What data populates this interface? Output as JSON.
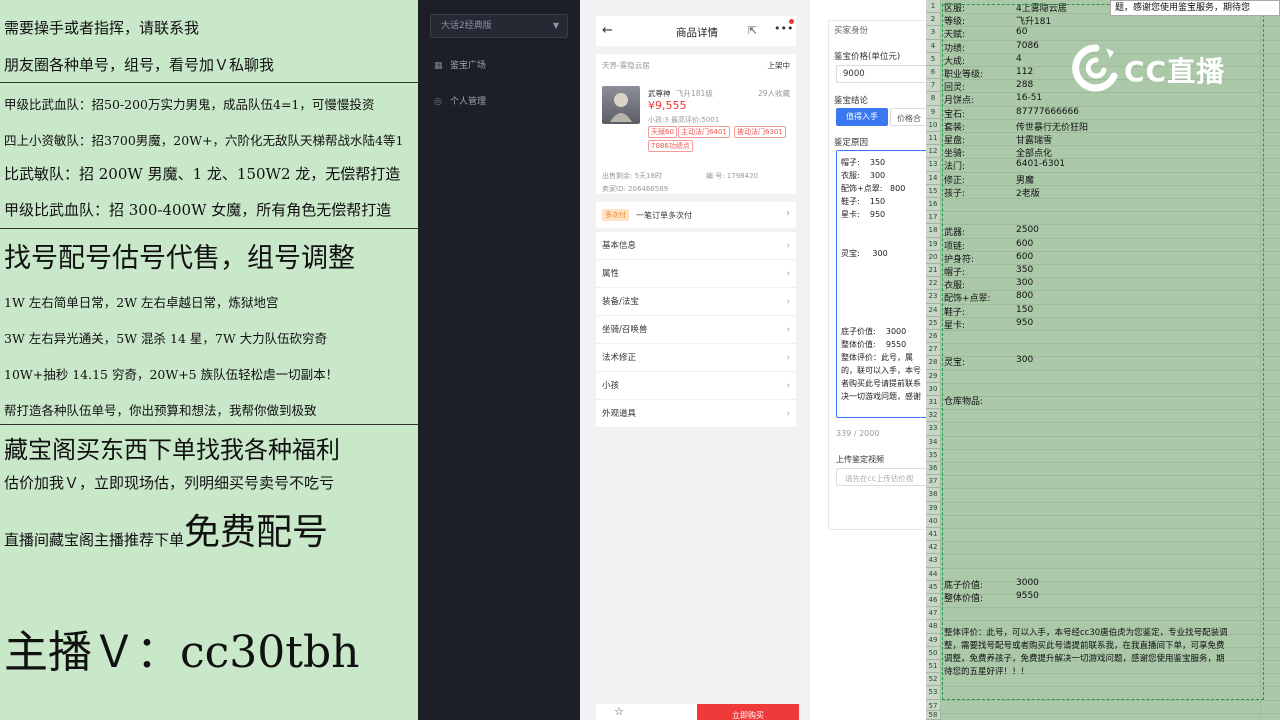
{
  "promo": {
    "line1": "需要操手或者指挥，请联系我",
    "line2": "朋友圈各种单号，组号，看号加Ｖ私聊我",
    "line3": "甲级比武血队：招50-200万实力男鬼，成品队伍4=1，可慢慢投资",
    "line4": "四上小资敏队：招3700男魔，20W+，六阶化无敌队天梯帮战水陆4等1",
    "line5": "比武敏队：招 200W 男魔、1 龙、150W2 龙，无偿帮打造",
    "line6": "甲级比武血队：招 300-400W 女魔，所有角色无偿帮打造",
    "line7": "找号配号估号代售，组号调整",
    "line8": "1W 左右简单日常，2W 左右卓越日常，炼狱地宫",
    "line9": "3W 左右异光通关，5W 混杀 14 星，7W 大力队伍砍穷奇",
    "line10": "10W+抽秒 14.15 穷奇，20W+5 族队伍轻松虐一切副本！",
    "line11": "帮打造各种队伍单号，你出预算和想法，我帮你做到极致",
    "line12": "藏宝阁买东西下单找我各种福利",
    "line13": "估价加我Ｖ，立即现场估，列明细买号卖号不吃亏",
    "line14a": "直播间藏宝阁主播推荐下单",
    "line14b": "免费配号",
    "line15": "主播Ｖ：cc30tbh"
  },
  "darkside": {
    "select_value": "大话2经典版",
    "nav1": "鉴宝广场",
    "nav2": "个人管理"
  },
  "phone": {
    "title": "商品详情",
    "server": "天界-雾隐云居",
    "status": "上架中",
    "char_name": "武尊神",
    "char_level": "飞升181级",
    "favorites": "29人收藏",
    "price": "¥9,555",
    "sub": "小孩:3 最高评价:5001",
    "tag1": "天赋60",
    "tag2": "主动法门6401",
    "tag3": "被动法门6301",
    "tag4": "7086功绩点",
    "remaining": "出售剩余: 5天18时",
    "serial": "编 号: 1798420",
    "seller": "卖家ID: 206466589",
    "promo_tag": "多次付",
    "promo_text": "一笔订单多次付",
    "rows": [
      "基本信息",
      "属性",
      "装备/法宝",
      "坐骑/召唤兽",
      "法术修正",
      "小孩",
      "外观道具"
    ],
    "buy_button": "立即购买"
  },
  "form": {
    "section": "买家身份",
    "price_label": "鉴宝价格(单位元)",
    "price_value": "9000",
    "conclusion_label": "鉴宝结论",
    "btn_worth": "值得入手",
    "btn_fair": "价格合",
    "reason_label": "鉴定原因",
    "reason_lines": [
      [
        "帽子:",
        "350"
      ],
      [
        "衣服:",
        "300"
      ],
      [
        "配饰+点翠:",
        "800"
      ],
      [
        "鞋子:",
        "150"
      ],
      [
        "星卡:",
        "950"
      ],
      [
        "",
        ""
      ],
      [
        "",
        ""
      ],
      [
        "灵宝:",
        "300"
      ]
    ],
    "base_label": "底子价值:",
    "base_value": "3000",
    "total_label": "整体价值:",
    "total_value": "9550",
    "eval_line1": "整体评价：此号，属",
    "eval_line2": "的，联可以入手，本号",
    "eval_line3": "者购买此号请提前联系",
    "eval_line4": "决一切游戏问题，感谢",
    "counter": "339 / 2000",
    "video_label": "上传鉴定视频",
    "video_placeholder": "请先在cc上传估价视"
  },
  "sheet": {
    "top_tip": "题，感谢您使用鉴宝服务，期待您",
    "logo_text": "CC直播",
    "rows": [
      {
        "n": "1",
        "k": "区服:",
        "v": "4上雾隐云居"
      },
      {
        "n": "2",
        "k": "等级:",
        "v": "飞升181"
      },
      {
        "n": "3",
        "k": "天赋:",
        "v": "60"
      },
      {
        "n": "4",
        "k": "功绩:",
        "v": "7086"
      },
      {
        "n": "5",
        "k": "大成:",
        "v": "4"
      },
      {
        "n": "6",
        "k": "职业等级:",
        "v": "112"
      },
      {
        "n": "7",
        "k": "回灵:",
        "v": "288"
      },
      {
        "n": "8",
        "k": "月饼点:",
        "v": "16-51"
      },
      {
        "n": "9",
        "k": "宝石:",
        "v": "87777666666"
      },
      {
        "n": "10",
        "k": "套装:",
        "v": "传世暴行无价狂阳"
      },
      {
        "n": "11",
        "k": "星盘:",
        "v": "甘露瑞雪"
      },
      {
        "n": "12",
        "k": "坐骑:",
        "v": "全部点化"
      },
      {
        "n": "13",
        "k": "法门:",
        "v": "6401-6301"
      },
      {
        "n": "14",
        "k": "修正:",
        "v": "男魔"
      },
      {
        "n": "15",
        "k": "孩子:",
        "v": "2老版"
      },
      {
        "n": "16",
        "k": "",
        "v": ""
      },
      {
        "n": "17",
        "k": "",
        "v": ""
      },
      {
        "n": "18",
        "k": "武器:",
        "v": "2500"
      },
      {
        "n": "19",
        "k": "项链:",
        "v": "600"
      },
      {
        "n": "20",
        "k": "护身符:",
        "v": "600"
      },
      {
        "n": "21",
        "k": "帽子:",
        "v": "350"
      },
      {
        "n": "22",
        "k": "衣服:",
        "v": "300"
      },
      {
        "n": "23",
        "k": "配饰+点翠:",
        "v": "800"
      },
      {
        "n": "24",
        "k": "鞋子:",
        "v": "150"
      },
      {
        "n": "25",
        "k": "星卡:",
        "v": "950"
      }
    ],
    "lingbao_k": "灵宝:",
    "lingbao_v": "300",
    "warehouse": "仓库物品:",
    "base_k": "底子价值:",
    "base_v": "3000",
    "total_k": "整体价值:",
    "total_v": "9550",
    "eval_lines": [
      "整体评价：此号，可以入手，本号经cc30唐伯虎为您鉴定，专业找号配装调",
      "整，需要找号配号或者购买此号请提前联系我，在我直播间下单，可享免费",
      "调整，免费养孩子，免费提升解决一切游戏问题，感谢您使用鉴宝服务，期",
      "待您的五星好评！！！"
    ],
    "bottom_rows": [
      "57",
      "58"
    ]
  },
  "colors": {
    "promo_bg": "#c9e7c9",
    "sheet_bg": "#abc8a9",
    "accent_blue": "#3a78f2",
    "price_red": "#e33333",
    "buy_red": "#f03a3a"
  }
}
